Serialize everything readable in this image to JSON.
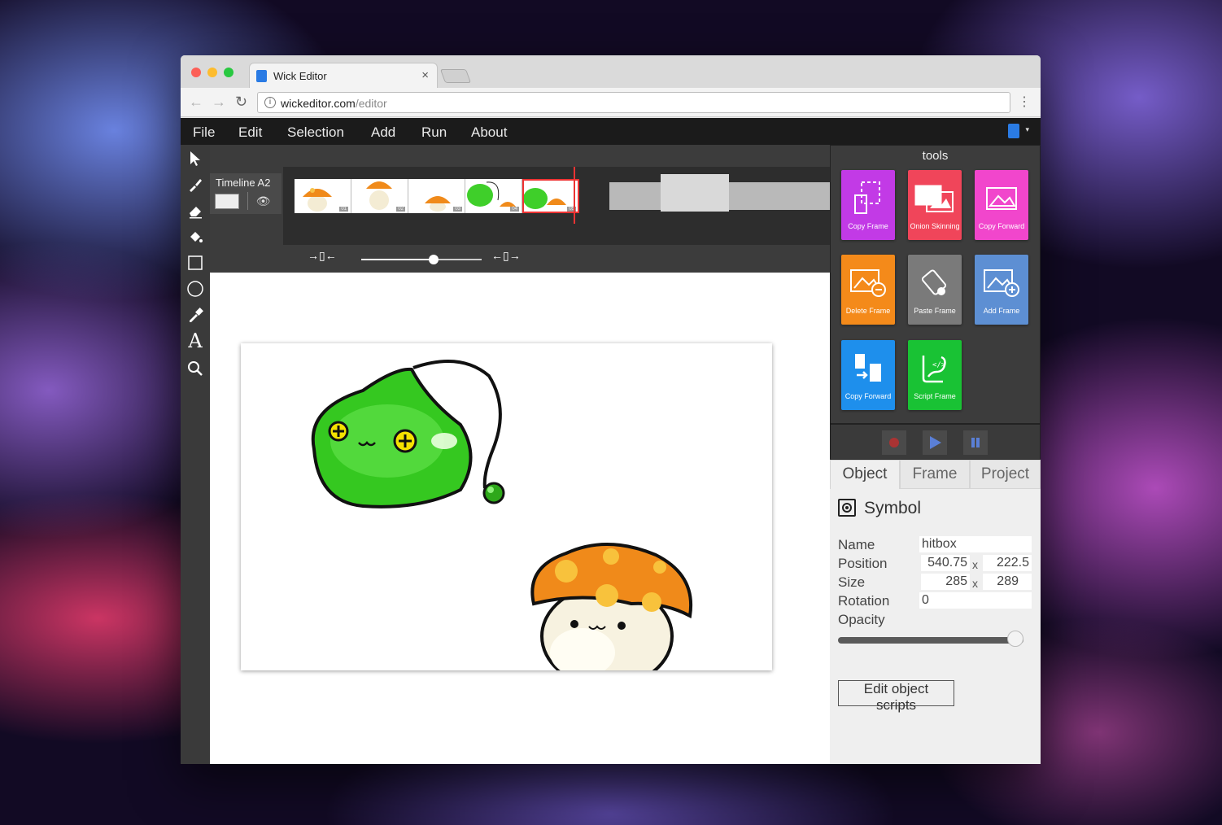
{
  "browser": {
    "tab_title": "Wick Editor",
    "tab_close": "×",
    "url_domain": "wickeditor.com",
    "url_path": "/editor",
    "back": "←",
    "forward": "→",
    "reload": "↻",
    "info": "i",
    "kebab": "⋮"
  },
  "menu": {
    "items": [
      "File",
      "Edit",
      "Selection",
      "Add",
      "Run",
      "About"
    ],
    "caret": "▾"
  },
  "toolbar": {
    "tools": [
      "cursor-icon",
      "brush-icon",
      "eraser-icon",
      "fill-bucket-icon",
      "rectangle-icon",
      "ellipse-icon",
      "eyedropper-icon",
      "text-icon",
      "zoom-icon"
    ],
    "text_tool_glyph": "A"
  },
  "timeline": {
    "layer_name": "Timeline A2",
    "eye_glyph": "👁",
    "frames": [
      {
        "num": "01"
      },
      {
        "num": "02"
      },
      {
        "num": "03"
      },
      {
        "num": "04"
      },
      {
        "num": "05"
      }
    ],
    "selected_frame": 5,
    "zoom_level": 0.6,
    "zoom_left_glyph": "→▯←",
    "zoom_right_glyph": "←▯→"
  },
  "tools_panel": {
    "title": "tools",
    "buttons": [
      {
        "label": "Copy Frame",
        "color": "#c23ae6",
        "icon": "copy-frame-icon"
      },
      {
        "label": "Onion Skinning",
        "color": "#f0455a",
        "icon": "onion-skin-icon"
      },
      {
        "label": "Copy Forward",
        "color": "#f146cc",
        "icon": "copy-forward-image-icon"
      },
      {
        "label": "Delete Frame",
        "color": "#f48a1a",
        "icon": "delete-frame-icon"
      },
      {
        "label": "Paste Frame",
        "color": "#7a7a7a",
        "icon": "paste-frame-icon"
      },
      {
        "label": "Add Frame",
        "color": "#5d8fd3",
        "icon": "add-frame-icon"
      },
      {
        "label": "Copy Forward",
        "color": "#1e8fec",
        "icon": "copy-forward-icon"
      },
      {
        "label": "Script Frame",
        "color": "#19c234",
        "icon": "script-frame-icon"
      }
    ]
  },
  "player": {
    "record_color": "#a33",
    "play_color": "#5a7fd6",
    "pause_color": "#5a7fd6"
  },
  "inspector": {
    "tabs": [
      "Object",
      "Frame",
      "Project"
    ],
    "active_tab": "Object",
    "type_label": "Symbol",
    "name_label": "Name",
    "name_value": "hitbox",
    "position_label": "Position",
    "position_x": "540.75",
    "position_y": "222.5",
    "size_label": "Size",
    "size_w": "285",
    "size_h": "289",
    "rotation_label": "Rotation",
    "rotation_value": "0",
    "opacity_label": "Opacity",
    "opacity_value": 1.0,
    "x_sep": "x",
    "edit_scripts": "Edit object scripts"
  }
}
